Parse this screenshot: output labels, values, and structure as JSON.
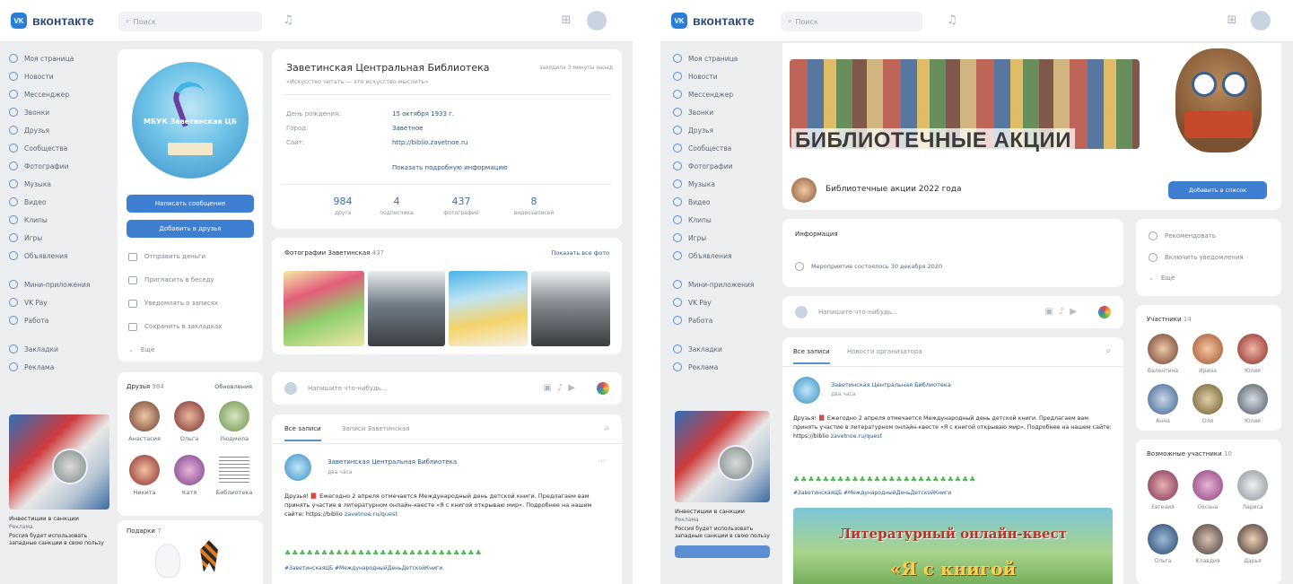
{
  "left": {
    "logo_badge": "VK",
    "logo_text": "вконтакте",
    "search_placeholder": "Поиск",
    "nav": [
      {
        "label": "Моя страница"
      },
      {
        "label": "Новости"
      },
      {
        "label": "Мессенджер"
      },
      {
        "label": "Звонки"
      },
      {
        "label": "Друзья"
      },
      {
        "label": "Сообщества"
      },
      {
        "label": "Фотографии"
      },
      {
        "label": "Музыка"
      },
      {
        "label": "Видео"
      },
      {
        "label": "Клипы"
      },
      {
        "label": "Игры"
      },
      {
        "label": "Объявления"
      },
      {
        "label": "Мини-приложения"
      },
      {
        "label": "VK Pay"
      },
      {
        "label": "Работа"
      },
      {
        "label": "Закладки"
      },
      {
        "label": "Реклама"
      }
    ],
    "ad": {
      "title": "Инвестиции в санкции",
      "subtitle": "Реклама",
      "body": "Россия будет использовать западные санкции в свою пользу"
    },
    "profile": {
      "avatar_text": "МБУК Заветинская ЦБ",
      "write_button": "Написать сообщение",
      "add_button": "Добавить в друзья",
      "actions": [
        "Отправить деньги",
        "Пригласить в беседу",
        "Уведомлять о записях",
        "Сохранить в закладках",
        "Ещё"
      ]
    },
    "page": {
      "name": "Заветинская Центральная Библиотека",
      "status_right": "заходила 3 минуты назад",
      "subtitle": "«Искусство читать — это искусство мыслить»",
      "info": [
        {
          "label": "День рождения:",
          "value": "15 октября 1933 г."
        },
        {
          "label": "Город:",
          "value": "Заветное"
        },
        {
          "label": "Сайт:",
          "value": "http://biblio.zavetnoe.ru"
        }
      ],
      "more_link": "Показать подробную информацию",
      "counters": [
        {
          "n": "984",
          "label": "друга"
        },
        {
          "n": "4",
          "label": "подписчика"
        },
        {
          "n": "437",
          "label": "фотографий"
        },
        {
          "n": "8",
          "label": "видеозаписей"
        }
      ]
    },
    "photos": {
      "title": "Фотографии Заветинская",
      "count": "437",
      "show_all": "Показать все фото"
    },
    "friends": {
      "title": "Друзья",
      "count": "984",
      "updates": "Обновления",
      "list": [
        "Анастасия",
        "Ольга",
        "Людмила",
        "Никита",
        "Катя",
        "Библиотека"
      ]
    },
    "gifts": {
      "title": "Подарки",
      "count": "7"
    },
    "composer_placeholder": "Напишите что-нибудь...",
    "wall": {
      "tab_all": "Все записи",
      "tab_own": "Записи Заветинская",
      "post_author": "Заветинская Центральная Библиотека",
      "post_time": "два часа",
      "post_text": "Друзья! 📕 Ежегодно 2 апреля отмечается Международный день детской книги. Предлагаем вам принять участие в литературном онлайн-квесте «Я с книгой открываю мир». Подробнее на нашем сайте: https://biblio",
      "post_link": "zavetnoe.ru/quest",
      "green": "♣♣♣♣♣♣♣♣♣♣♣♣♣♣♣♣♣♣♣♣♣♣♣♣♣♣♣",
      "hashtags": "#ЗаветинскаяЦБ #МеждународныйДеньДетскойКниги"
    }
  },
  "right": {
    "logo_badge": "VK",
    "logo_text": "вконтакте",
    "search_placeholder": "Поиск",
    "nav": [
      {
        "label": "Моя страница"
      },
      {
        "label": "Новости"
      },
      {
        "label": "Мессенджер"
      },
      {
        "label": "Звонки"
      },
      {
        "label": "Друзья"
      },
      {
        "label": "Сообщества"
      },
      {
        "label": "Фотографии"
      },
      {
        "label": "Музыка"
      },
      {
        "label": "Видео"
      },
      {
        "label": "Клипы"
      },
      {
        "label": "Игры"
      },
      {
        "label": "Объявления"
      },
      {
        "label": "Мини-приложения"
      },
      {
        "label": "VK Pay"
      },
      {
        "label": "Работа"
      },
      {
        "label": "Закладки"
      },
      {
        "label": "Реклама"
      }
    ],
    "ad": {
      "title": "Инвестиции в санкции",
      "subtitle": "Реклама",
      "body": "Россия будет использовать западные санкции в свою пользу"
    },
    "cover_title": "БИБЛИОТЕЧНЫЕ АКЦИИ",
    "group": {
      "name": "Библиотечные акции 2022 года",
      "add_button": "Добавить в список"
    },
    "info_title": "Информация",
    "event_text": "Мероприятие состоялось 30 декабря 2020",
    "composer_placeholder": "Напишите что-нибудь...",
    "side_menu": [
      "Рекомендовать",
      "Включить уведомления",
      "Ещё"
    ],
    "wall": {
      "tab_all": "Все записи",
      "tab_org": "Новости организатора",
      "post_author": "Заветинская Центральная Библиотека",
      "post_time": "два часа",
      "post_text": "Друзья! 📕 Ежегодно 2 апреля отмечается Международный день детской книги. Предлагаем вам принять участие в литературном онлайн-квесте «Я с книгой открываю мир». Подробнее на нашем сайте: https://biblio",
      "post_link": "zavetnoe.ru/quest",
      "green": "♣♣♣♣♣♣♣♣♣♣♣♣♣♣♣♣♣♣♣♣♣♣♣♣♣",
      "hashtags": "#ЗаветинскаяЦБ #МеждународныйДеньДетскойКниги",
      "quest_line1": "Литературный онлайн-квест",
      "quest_line2": "«Я с книгой"
    },
    "participants": {
      "title": "Участники",
      "count": "14",
      "list": [
        "Валентина",
        "Ирина",
        "Юлия",
        "Анна",
        "Оля",
        "Юлия"
      ]
    },
    "maybe": {
      "title": "Возможные участники",
      "count": "10",
      "list": [
        "Евгения",
        "Оксана",
        "Лариса",
        "Ольга",
        "Клавдия",
        "Дарья"
      ]
    }
  }
}
